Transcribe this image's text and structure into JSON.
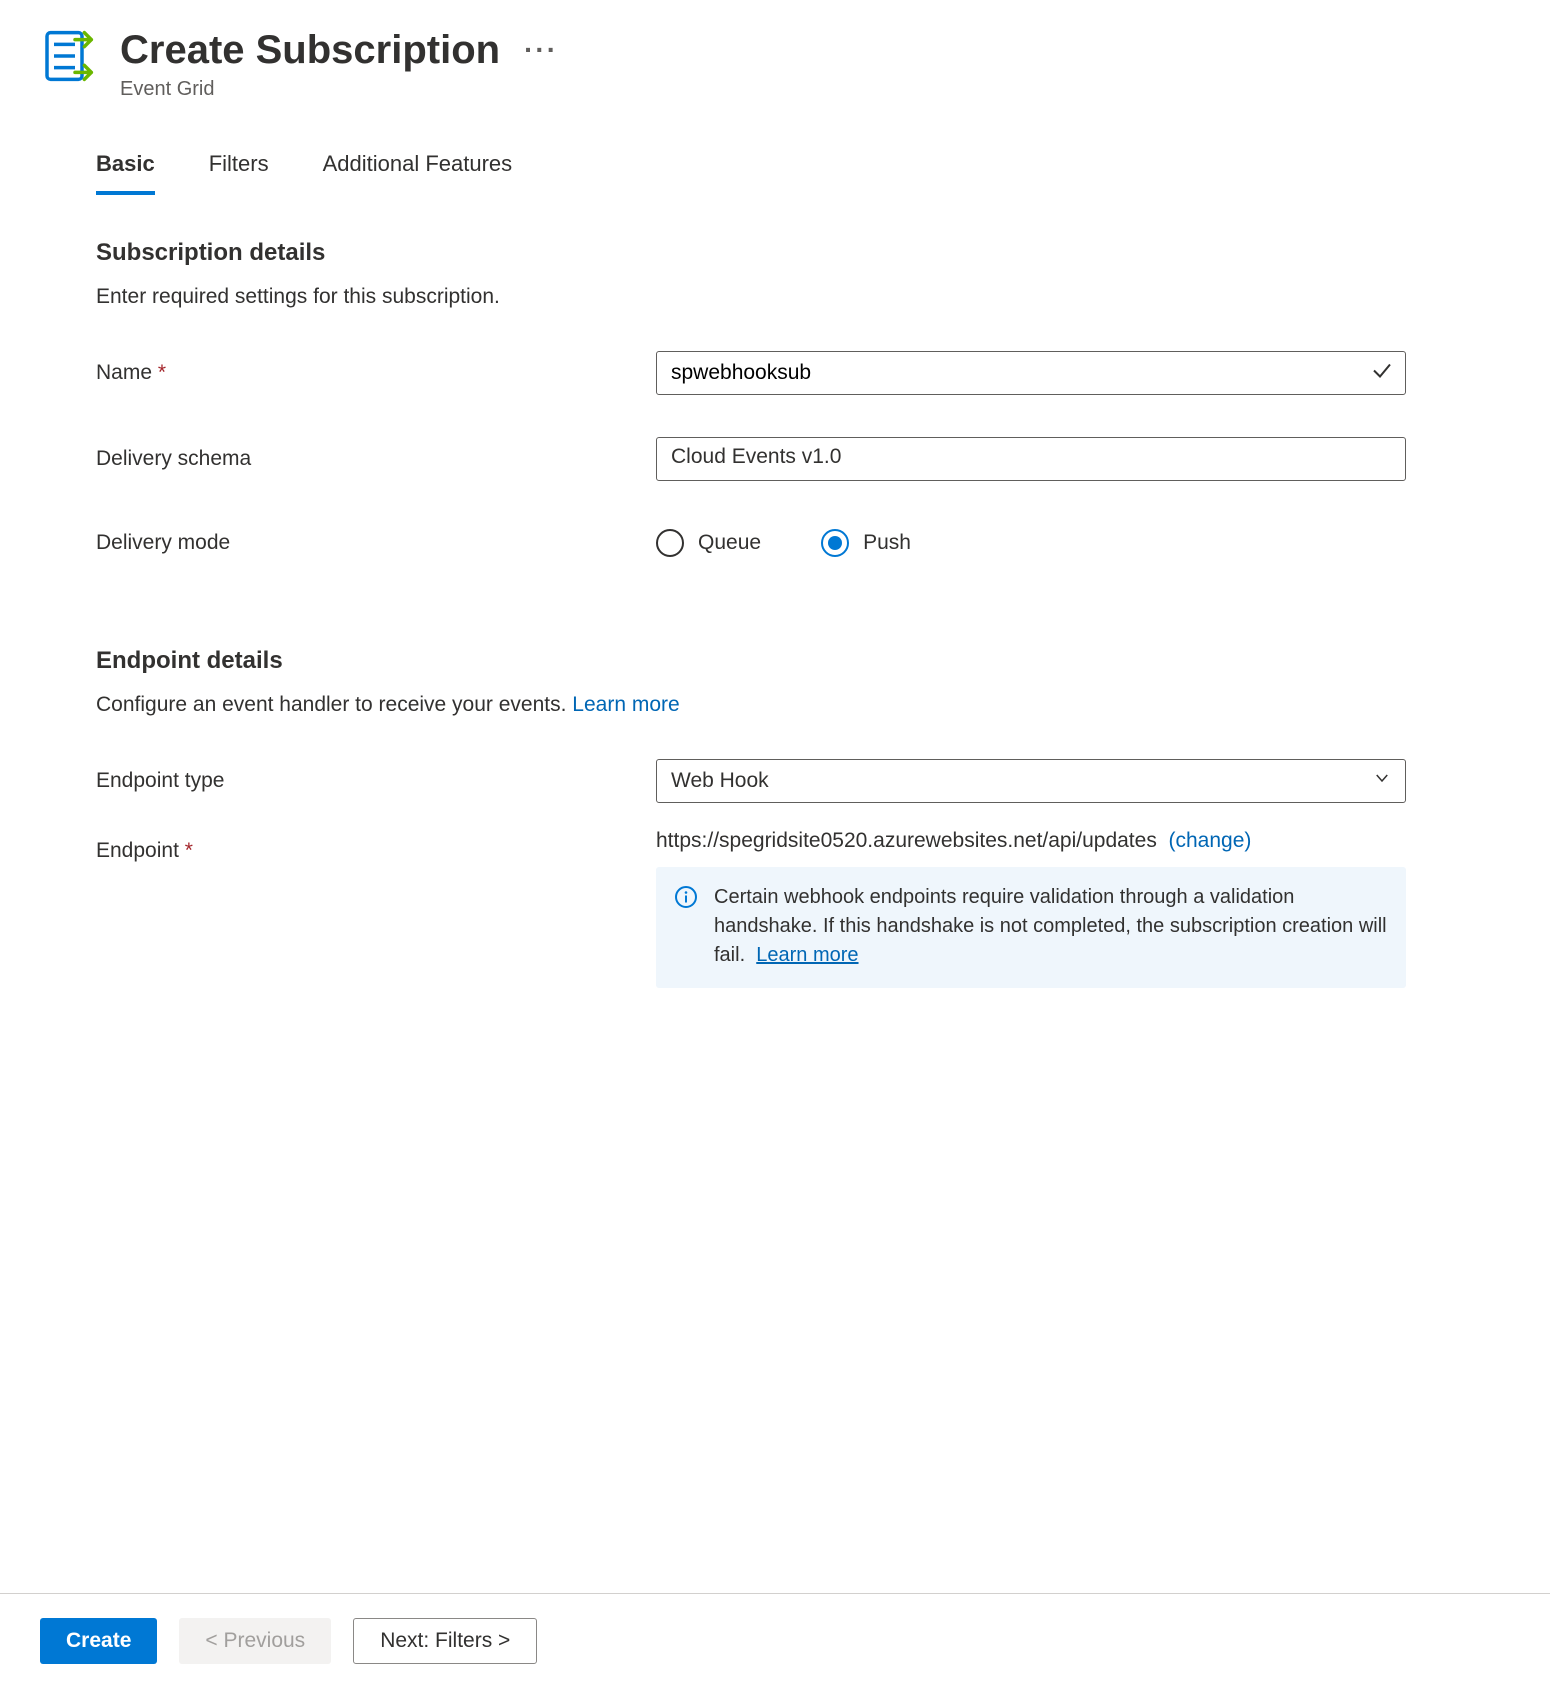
{
  "header": {
    "title": "Create Subscription",
    "subtitle": "Event Grid"
  },
  "tabs": [
    "Basic",
    "Filters",
    "Additional Features"
  ],
  "subscription": {
    "section_title": "Subscription details",
    "section_desc": "Enter required settings for this subscription.",
    "name_label": "Name",
    "name_value": "spwebhooksub",
    "schema_label": "Delivery schema",
    "schema_value": "Cloud Events v1.0",
    "mode_label": "Delivery mode",
    "mode_options": {
      "queue": "Queue",
      "push": "Push"
    }
  },
  "endpoint": {
    "section_title": "Endpoint details",
    "section_desc": "Configure an event handler to receive your events.",
    "learn_more": "Learn more",
    "type_label": "Endpoint type",
    "type_value": "Web Hook",
    "endpoint_label": "Endpoint",
    "endpoint_value": "https://spegridsite0520.azurewebsites.net/api/updates",
    "change_label": "(change)",
    "info_text": "Certain webhook endpoints require validation through a validation handshake. If this handshake is not completed, the subscription creation will fail.",
    "info_learn_more": "Learn more"
  },
  "footer": {
    "create": "Create",
    "previous": "< Previous",
    "next": "Next: Filters >"
  }
}
